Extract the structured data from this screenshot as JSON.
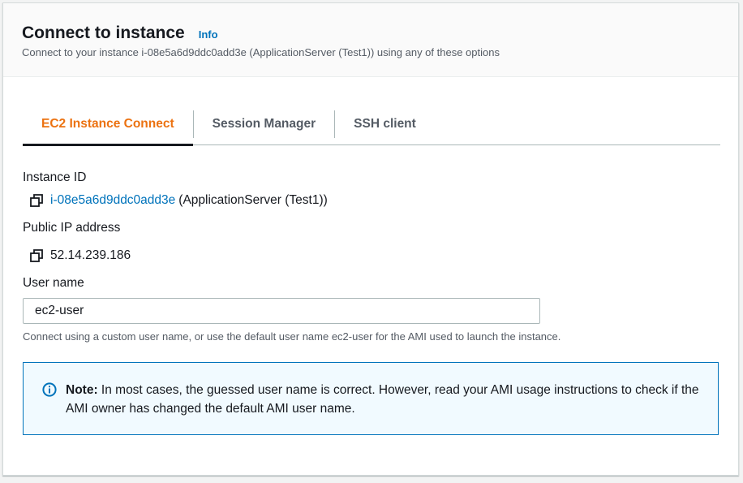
{
  "header": {
    "title": "Connect to instance",
    "info_label": "Info",
    "subtitle": "Connect to your instance i-08e5a6d9ddc0add3e (ApplicationServer (Test1)) using any of these options"
  },
  "tabs": [
    {
      "label": "EC2 Instance Connect",
      "active": true
    },
    {
      "label": "Session Manager",
      "active": false
    },
    {
      "label": "SSH client",
      "active": false
    }
  ],
  "instance": {
    "label": "Instance ID",
    "id": "i-08e5a6d9ddc0add3e",
    "name": "(ApplicationServer (Test1))"
  },
  "public_ip": {
    "label": "Public IP address",
    "value": "52.14.239.186"
  },
  "user_name": {
    "label": "User name",
    "value": "ec2-user",
    "hint": "Connect using a custom user name, or use the default user name ec2-user for the AMI used to launch the instance."
  },
  "alert": {
    "icon": "info-icon",
    "strong": "Note:",
    "text": "In most cases, the guessed user name is correct. However, read your AMI usage instructions to check if the AMI owner has changed the default AMI user name."
  },
  "colors": {
    "accent_orange": "#ec7211",
    "link_blue": "#0073bb",
    "alert_bg": "#f1faff"
  }
}
